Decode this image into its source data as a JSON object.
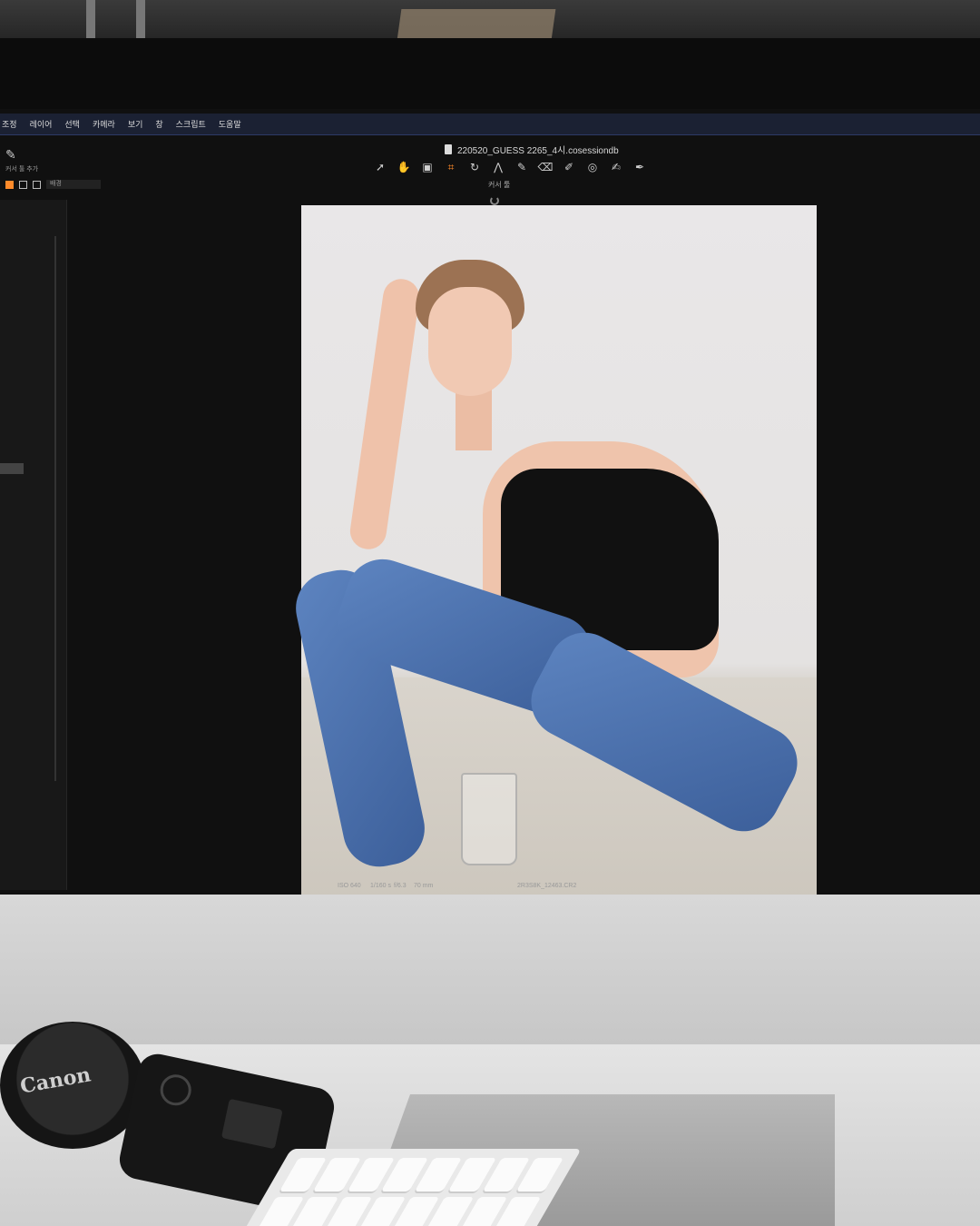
{
  "app": {
    "menu": [
      "조정",
      "레이어",
      "선택",
      "카메라",
      "보기",
      "창",
      "스크립트",
      "도움말"
    ],
    "window_title": "220520_GUESS 2265_4시.cosessiondb",
    "cursor_tool_label": "커서 툴",
    "left_tool_caption": "커서 툴 추가",
    "view_select": "배경",
    "photo_exif": [
      "ISO 640",
      "1/160 s",
      "f/6.3",
      "70 mm"
    ],
    "photo_filename": "2R3S8K_12463.CR2",
    "left_panel_file": "2R3S8K_12463.CR2"
  },
  "toolbar": {
    "tools": [
      {
        "icon": "pointer-icon",
        "glyph": "➚"
      },
      {
        "icon": "hand-icon",
        "glyph": "✋"
      },
      {
        "icon": "capture-icon",
        "glyph": "▣"
      },
      {
        "icon": "crop-icon",
        "glyph": "⌗",
        "active": true
      },
      {
        "icon": "rotate-icon",
        "glyph": "↻"
      },
      {
        "icon": "keystone-icon",
        "glyph": "⋀"
      },
      {
        "icon": "brush-icon",
        "glyph": "✎"
      },
      {
        "icon": "eraser-icon",
        "glyph": "⌫"
      },
      {
        "icon": "color-picker-icon",
        "glyph": "✐"
      },
      {
        "icon": "spot-icon",
        "glyph": "◎"
      },
      {
        "icon": "annotate-icon",
        "glyph": "✍"
      },
      {
        "icon": "pen-icon",
        "glyph": "✒"
      }
    ]
  },
  "desk": {
    "lens_cap_brand": "Canon"
  },
  "colors": {
    "accent": "#ff8a2a",
    "menubar": "#1b2133",
    "app_background": "#101010"
  }
}
